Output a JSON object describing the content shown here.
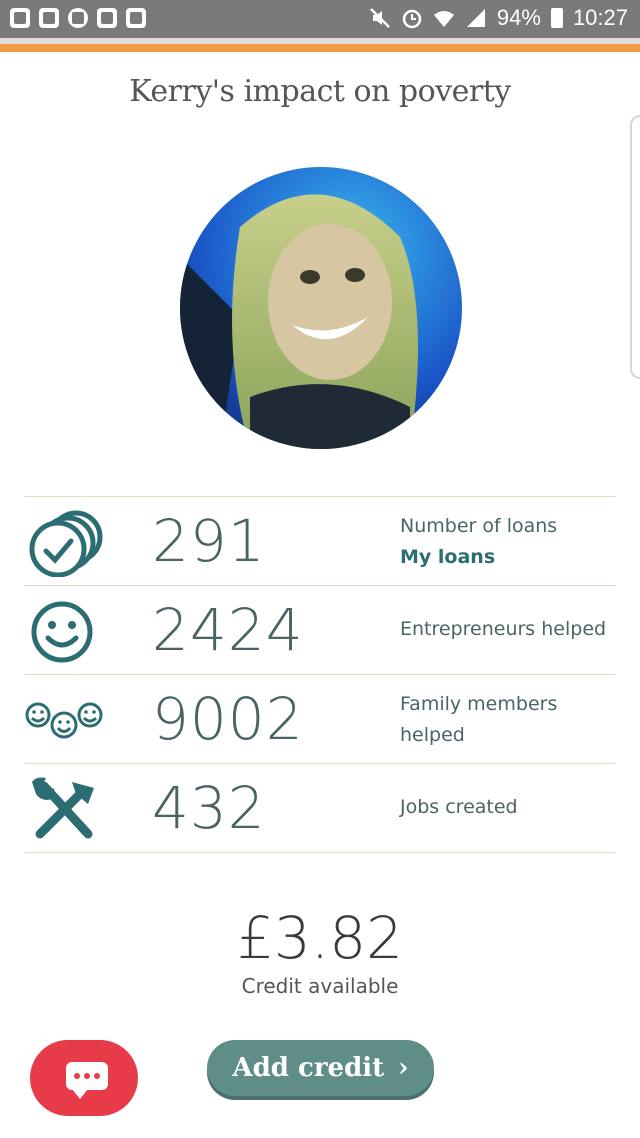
{
  "status_bar": {
    "icons_left": [
      "app-icon",
      "outlook-icon",
      "storage-icon",
      "bbc-news-icon",
      "calendar-icon"
    ],
    "icons_right": [
      "mute-icon",
      "alarm-icon",
      "wifi-icon",
      "signal-icon"
    ],
    "battery": "94%",
    "time": "10:27"
  },
  "page": {
    "title": "Kerry's impact on poverty"
  },
  "stats": [
    {
      "icon": "loans-stack-check-icon",
      "value": "291",
      "label": "Number of loans",
      "link": "My loans"
    },
    {
      "icon": "smiley-icon",
      "value": "2424",
      "label": "Entrepreneurs helped"
    },
    {
      "icon": "family-smileys-icon",
      "value": "9002",
      "label_line1": "Family members",
      "label_line2": "helped"
    },
    {
      "icon": "hammer-wrench-icon",
      "value": "432",
      "label": "Jobs created"
    }
  ],
  "credit": {
    "amount": "£3.82",
    "label": "Credit available"
  },
  "buttons": {
    "add_credit": "Add credit",
    "add_credit_chevron": "›"
  },
  "colors": {
    "accent_orange": "#f39a42",
    "teal": "#2c6d72",
    "button_teal": "#5f8e89",
    "chat_red": "#e83b4a"
  }
}
